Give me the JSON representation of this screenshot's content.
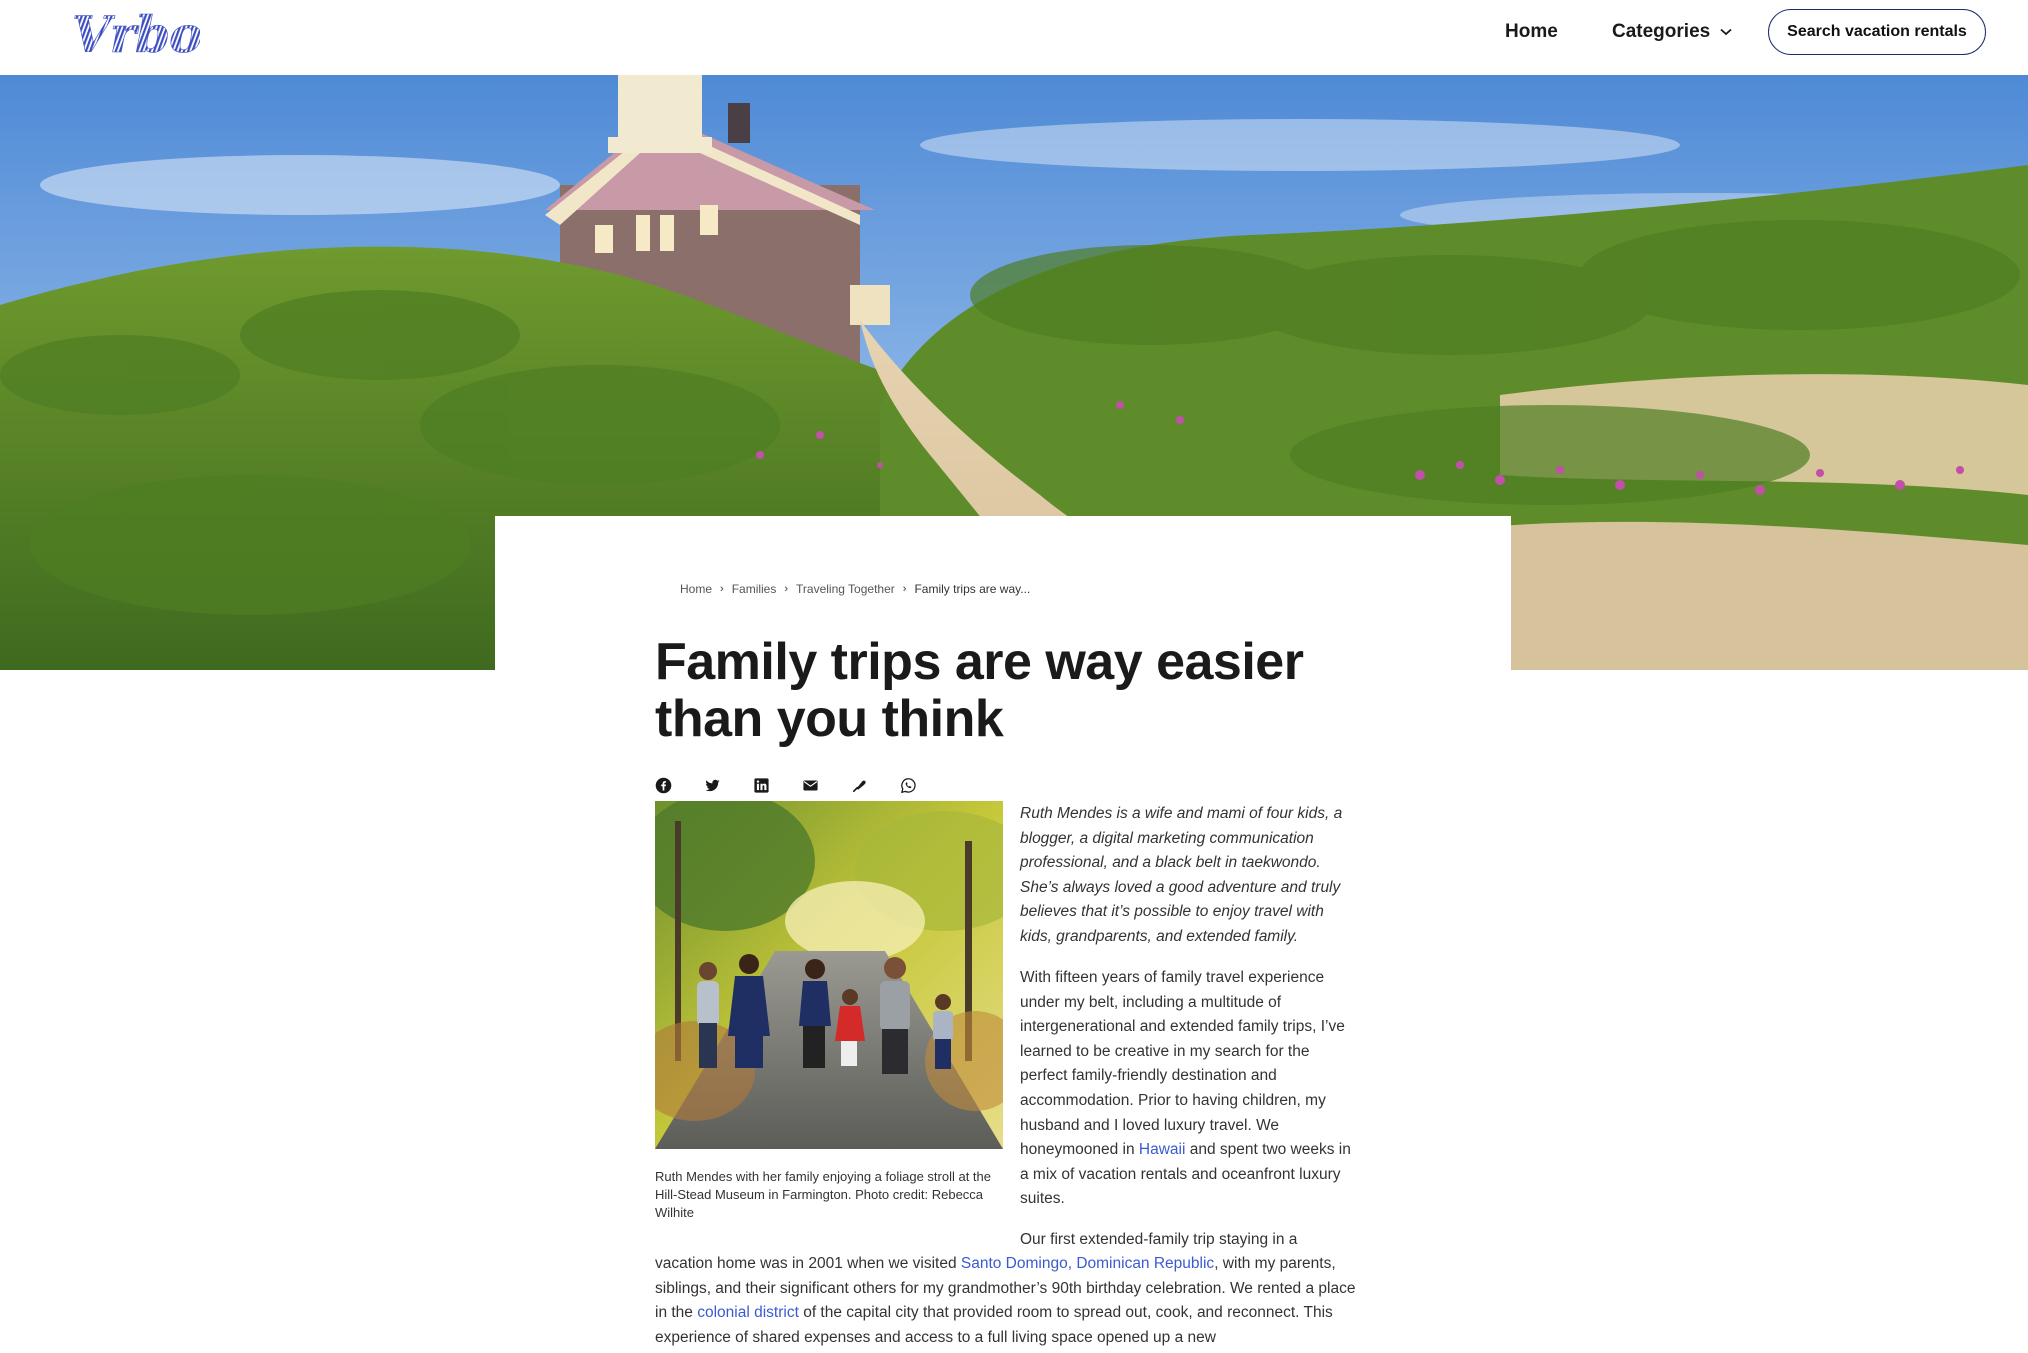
{
  "header": {
    "logo": "Vrbo",
    "nav_home": "Home",
    "nav_categories": "Categories",
    "search_button": "Search vacation rentals"
  },
  "breadcrumb": {
    "items": [
      "Home",
      "Families",
      "Traveling Together"
    ],
    "current": "Family trips are way..."
  },
  "article": {
    "title": "Family trips are way easier than you think",
    "share_icons": [
      "facebook-icon",
      "twitter-icon",
      "linkedin-icon",
      "email-icon",
      "link-icon",
      "whatsapp-icon"
    ],
    "photo_caption": "Ruth Mendes with her family enjoying a foliage stroll at the Hill-Stead Museum in Farmington. Photo credit: Rebecca Wilhite",
    "intro": "Ruth Mendes is a wife and mami of four kids, a blogger, a digital marketing communication professional, and a black belt in taekwondo. She’s always loved a good adventure and truly believes that it’s possible to enjoy travel with kids, grandparents, and extended family.",
    "para1_before": "With fifteen years of family travel experience under my belt, including a multitude of intergenerational and extended family trips, I’ve learned to be creative in my search for the perfect family-friendly destination and accommodation. Prior to having children, my husband and I loved luxury travel. We honeymooned in ",
    "para1_link": "Hawaii",
    "para1_after": " and spent two weeks in a mix of vacation rentals and oceanfront luxury suites.",
    "para2_start": "Our first extended-family trip staying in a",
    "para2_before": "vacation home was in 2001 when we visited ",
    "para2_link1": "Santo Domingo, Dominican Republic",
    "para2_mid": ", with my parents, siblings, and their significant others for my grandmother’s 90th birthday celebration. We rented a place in the ",
    "para2_link2": "colonial district",
    "para2_after": " of the capital city that provided room to spread out, cook, and reconnect. This experience of shared expenses and access to a full living space opened up a new"
  },
  "colors": {
    "brand": "#3d4ec0",
    "link": "#3a5bd0",
    "text": "#1a1a1a"
  }
}
